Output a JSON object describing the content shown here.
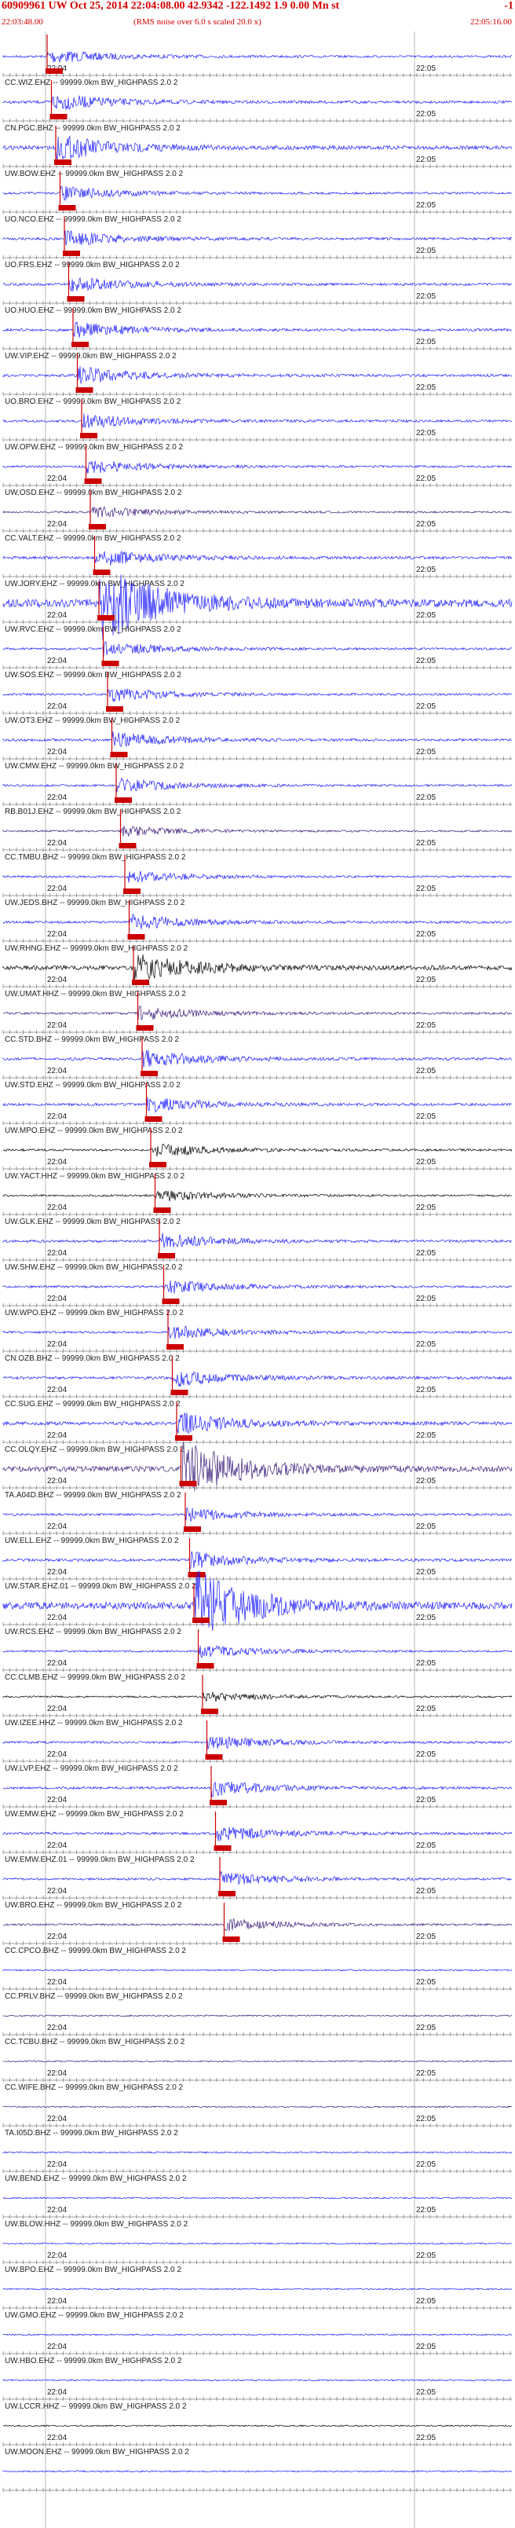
{
  "header": {
    "event_line": "60909961 UW Oct 25, 2014 22:04:08.00   42.9342 -122.1492  1.9 0.00 Mn st",
    "event_tail": "-1",
    "start_time": "22:03:48.00",
    "note": "(RMS noise over 6.0 s scaled 20.0 x)",
    "end_time": "22:05:16.00"
  },
  "chart_data": {
    "type": "seismogram",
    "time_range": [
      "22:03:48.00",
      "22:05:16.00"
    ],
    "minute_ticks": [
      "22:04",
      "22:05"
    ],
    "pick_color": "#cc0000",
    "traces": [
      {
        "label": "",
        "color": "#1a1aff",
        "amplitude": 0.45,
        "pick_s": 0,
        "tick_24": "22:04",
        "tick_25": "22:05"
      },
      {
        "label": "CC.WIZ.EHZ -- 99999.0km BW_HIGHPASS  2.0  2",
        "color": "#1a1aff",
        "amplitude": 0.55,
        "pick_s": 0,
        "tick_24": "",
        "tick_25": "22:05"
      },
      {
        "label": "CN.PGC.BHZ -- 99999.0km BW_HIGHPASS  2.0  2",
        "color": "#1a1aff",
        "amplitude": 0.8,
        "pick_s": 0,
        "tick_24": "",
        "tick_25": "22:05"
      },
      {
        "label": "UW.BOW.EHZ -- 99999.0km BW_HIGHPASS  2.0  2",
        "color": "#1a1aff",
        "amplitude": 0.45,
        "pick_s": 0,
        "tick_24": "",
        "tick_25": "22:05"
      },
      {
        "label": "UO.NCO.EHZ -- 99999.0km BW_HIGHPASS  2.0  2",
        "color": "#1a1aff",
        "amplitude": 0.5,
        "pick_s": 0,
        "tick_24": "",
        "tick_25": "22:05"
      },
      {
        "label": "UO.FRS.EHZ -- 99999.0km BW_HIGHPASS  2.0  2",
        "color": "#1a1aff",
        "amplitude": 0.5,
        "pick_s": 0,
        "tick_24": "",
        "tick_25": "22:05"
      },
      {
        "label": "UO.HUO.EHZ -- 99999.0km BW_HIGHPASS  2.0  2",
        "color": "#1a1aff",
        "amplitude": 0.5,
        "pick_s": 0,
        "tick_24": "",
        "tick_25": "22:05"
      },
      {
        "label": "UW.VIP.EHZ -- 99999.0km BW_HIGHPASS  2.0  2",
        "color": "#1a1aff",
        "amplitude": 0.55,
        "pick_s": 0,
        "tick_24": "",
        "tick_25": "22:05"
      },
      {
        "label": "UO.BRO.EHZ -- 99999.0km BW_HIGHPASS  2.0  2",
        "color": "#1a1aff",
        "amplitude": 0.5,
        "pick_s": 0,
        "tick_24": "",
        "tick_25": "22:05"
      },
      {
        "label": "UW.OPW.EHZ -- 99999.0km BW_HIGHPASS  2.0  2",
        "color": "#1a1aff",
        "amplitude": 0.45,
        "pick_s": 0,
        "tick_24": "22:04",
        "tick_25": "22:05"
      },
      {
        "label": "UW.OSD.EHZ -- 99999.0km BW_HIGHPASS  2.0  2",
        "color": "#3a1a7a",
        "amplitude": 0.4,
        "pick_s": 0,
        "tick_24": "22:04",
        "tick_25": "22:05"
      },
      {
        "label": "CC.VALT.EHZ -- 99999.0km BW_HIGHPASS  2.0  2",
        "color": "#1a1aff",
        "amplitude": 0.55,
        "pick_s": 0,
        "tick_24": "",
        "tick_25": "22:05"
      },
      {
        "label": "UW.JORY.EHZ -- 99999.0km BW_HIGHPASS  2.0  2",
        "color": "#1a1aff",
        "amplitude": 1.6,
        "pick_s": 0,
        "tick_24": "22:04",
        "tick_25": "22:05"
      },
      {
        "label": "UW.RVC.EHZ -- 99999.0km BW_HIGHPASS  2.0  2",
        "color": "#1a1aff",
        "amplitude": 0.45,
        "pick_s": 0,
        "tick_24": "22:04",
        "tick_25": "22:05"
      },
      {
        "label": "UW.SOS.EHZ -- 99999.0km BW_HIGHPASS  2.0  2",
        "color": "#1a1aff",
        "amplitude": 0.45,
        "pick_s": 0,
        "tick_24": "22:04",
        "tick_25": "22:05"
      },
      {
        "label": "UW.OT3.EHZ -- 99999.0km BW_HIGHPASS  2.0  2",
        "color": "#1a1aff",
        "amplitude": 0.5,
        "pick_s": 0,
        "tick_24": "22:04",
        "tick_25": "22:05"
      },
      {
        "label": "UW.CMW.EHZ -- 99999.0km BW_HIGHPASS  2.0  2",
        "color": "#1a1aff",
        "amplitude": 0.45,
        "pick_s": 0,
        "tick_24": "22:04",
        "tick_25": "22:05"
      },
      {
        "label": "RB.B01J.EHZ -- 99999.0km BW_HIGHPASS  2.0  2",
        "color": "#3a1a7a",
        "amplitude": 0.35,
        "pick_s": 0,
        "tick_24": "22:04",
        "tick_25": "22:05"
      },
      {
        "label": "CC.TMBU.BHZ -- 99999.0km BW_HIGHPASS  2.0  2",
        "color": "#1a1aff",
        "amplitude": 0.4,
        "pick_s": 0,
        "tick_24": "22:04",
        "tick_25": "22:05"
      },
      {
        "label": "UW.JEDS.BHZ -- 99999.0km BW_HIGHPASS  2.0  2",
        "color": "#1a1aff",
        "amplitude": 0.5,
        "pick_s": 0,
        "tick_24": "22:04",
        "tick_25": "22:05"
      },
      {
        "label": "UW.RHNG.EHZ -- 99999.0km BW_HIGHPASS  2.0  2",
        "color": "#000000",
        "amplitude": 0.9,
        "pick_s": 0,
        "tick_24": "22:04",
        "tick_25": "22:05"
      },
      {
        "label": "UW.UMAT.HHZ -- 99999.0km BW_HIGHPASS  2.0  2",
        "color": "#3a1a7a",
        "amplitude": 0.45,
        "pick_s": 0,
        "tick_24": "22:04",
        "tick_25": "22:05"
      },
      {
        "label": "CC.STD.BHZ -- 99999.0km BW_HIGHPASS  2.0  2",
        "color": "#1a1aff",
        "amplitude": 0.55,
        "pick_s": 0,
        "tick_24": "22:04",
        "tick_25": "22:05"
      },
      {
        "label": "UW.STD.EHZ -- 99999.0km BW_HIGHPASS  2.0  2",
        "color": "#1a1aff",
        "amplitude": 0.5,
        "pick_s": 0,
        "tick_24": "22:04",
        "tick_25": "22:05"
      },
      {
        "label": "UW.MPO.EHZ -- 99999.0km BW_HIGHPASS  2.0  2",
        "color": "#000000",
        "amplitude": 0.45,
        "pick_s": 0,
        "tick_24": "22:04",
        "tick_25": "22:05"
      },
      {
        "label": "UW.YACT.HHZ -- 99999.0km BW_HIGHPASS  2.0  2",
        "color": "#000000",
        "amplitude": 0.4,
        "pick_s": 0,
        "tick_24": "22:04",
        "tick_25": "22:05"
      },
      {
        "label": "UW.GLK.EHZ -- 99999.0km BW_HIGHPASS  2.0  2",
        "color": "#1a1aff",
        "amplitude": 0.5,
        "pick_s": 0,
        "tick_24": "22:04",
        "tick_25": "22:05"
      },
      {
        "label": "UW.SHW.EHZ -- 99999.0km BW_HIGHPASS  2.0  2",
        "color": "#1a1aff",
        "amplitude": 0.45,
        "pick_s": 0,
        "tick_24": "22:04",
        "tick_25": "22:05"
      },
      {
        "label": "UW.WPO.EHZ -- 99999.0km BW_HIGHPASS  2.0  2",
        "color": "#1a1aff",
        "amplitude": 0.45,
        "pick_s": 0,
        "tick_24": "22:04",
        "tick_25": "22:05"
      },
      {
        "label": "CN.OZB.BHZ -- 99999.0km BW_HIGHPASS  2.0  2",
        "color": "#1a1aff",
        "amplitude": 0.55,
        "pick_s": 0,
        "tick_24": "22:04",
        "tick_25": "22:05"
      },
      {
        "label": "CC.SUG.EHZ -- 99999.0km BW_HIGHPASS  2.0  2",
        "color": "#1a1aff",
        "amplitude": 0.7,
        "pick_s": 0,
        "tick_24": "22:04",
        "tick_25": "22:05"
      },
      {
        "label": "CC.OLQY.EHZ -- 99999.0km BW_HIGHPASS  2.0  2",
        "color": "#3a1a7a",
        "amplitude": 1.1,
        "pick_s": 0,
        "tick_24": "22:04",
        "tick_25": "22:05"
      },
      {
        "label": "TA.A04D.BHZ -- 99999.0km BW_HIGHPASS  2.0  2",
        "color": "#1a1aff",
        "amplitude": 0.45,
        "pick_s": 0,
        "tick_24": "22:04",
        "tick_25": "22:05"
      },
      {
        "label": "UW.ELL.EHZ -- 99999.0km BW_HIGHPASS  2.0  2",
        "color": "#1a1aff",
        "amplitude": 0.55,
        "pick_s": 0,
        "tick_24": "22:04",
        "tick_25": "22:05"
      },
      {
        "label": "UW.STAR.EHZ.01 -- 99999.0km BW_HIGHPASS  2.0  2",
        "color": "#1a1aff",
        "amplitude": 1.4,
        "pick_s": 0,
        "tick_24": "22:04",
        "tick_25": "22:05"
      },
      {
        "label": "UW.RCS.EHZ -- 99999.0km BW_HIGHPASS  2.0  2",
        "color": "#1a1aff",
        "amplitude": 0.4,
        "pick_s": 0,
        "tick_24": "22:04",
        "tick_25": "22:05"
      },
      {
        "label": "CC.CLMB.EHZ -- 99999.0km BW_HIGHPASS  2.0  2",
        "color": "#000000",
        "amplitude": 0.35,
        "pick_s": 0,
        "tick_24": "22:04",
        "tick_25": "22:05"
      },
      {
        "label": "UW.IZEE.HHZ -- 99999.0km BW_HIGHPASS  2.0  2",
        "color": "#1a1aff",
        "amplitude": 0.45,
        "pick_s": 0,
        "tick_24": "22:04",
        "tick_25": "22:05"
      },
      {
        "label": "UW.LVP.EHZ -- 99999.0km BW_HIGHPASS  2.0  2",
        "color": "#1a1aff",
        "amplitude": 0.5,
        "pick_s": 0,
        "tick_24": "22:04",
        "tick_25": "22:05"
      },
      {
        "label": "UW.EMW.EHZ -- 99999.0km BW_HIGHPASS  2.0  2",
        "color": "#1a1aff",
        "amplitude": 0.5,
        "pick_s": 0,
        "tick_24": "22:04",
        "tick_25": "22:05"
      },
      {
        "label": "UW.EMW.EHZ.01 -- 99999.0km BW_HIGHPASS  2.0  2",
        "color": "#1a1aff",
        "amplitude": 0.45,
        "pick_s": 0,
        "tick_24": "22:04",
        "tick_25": "22:05"
      },
      {
        "label": "UW.BRO.EHZ -- 99999.0km BW_HIGHPASS  2.0  2",
        "color": "#3a1a7a",
        "amplitude": 0.4,
        "pick_s": 0,
        "tick_24": "22:04",
        "tick_25": "22:05"
      },
      {
        "label": "CC.CPCO.BHZ -- 99999.0km BW_HIGHPASS  2.0  2",
        "color": "#1a1aff",
        "amplitude": 0.3,
        "pick_s": null,
        "tick_24": "22:04",
        "tick_25": "22:05"
      },
      {
        "label": "CC.PRLV.BHZ -- 99999.0km BW_HIGHPASS  2.0  2",
        "color": "#3a1a7a",
        "amplitude": 0.3,
        "pick_s": null,
        "tick_24": "22:04",
        "tick_25": "22:05"
      },
      {
        "label": "CC.TCBU.BHZ -- 99999.0km BW_HIGHPASS  2.0  2",
        "color": "#3a1a7a",
        "amplitude": 0.3,
        "pick_s": null,
        "tick_24": "22:04",
        "tick_25": "22:05"
      },
      {
        "label": "CC.WIFE.BHZ -- 99999.0km BW_HIGHPASS  2.0  2",
        "color": "#3a1a7a",
        "amplitude": 0.3,
        "pick_s": null,
        "tick_24": "22:04",
        "tick_25": "22:05"
      },
      {
        "label": "TA.I05D.BHZ -- 99999.0km BW_HIGHPASS  2.0  2",
        "color": "#1a1aff",
        "amplitude": 0.3,
        "pick_s": null,
        "tick_24": "22:04",
        "tick_25": "22:05"
      },
      {
        "label": "UW.BEND.EHZ -- 99999.0km BW_HIGHPASS  2.0  2",
        "color": "#1a1aff",
        "amplitude": 0.3,
        "pick_s": null,
        "tick_24": "22:04",
        "tick_25": "22:05"
      },
      {
        "label": "UW.BLOW.HHZ -- 99999.0km BW_HIGHPASS  2.0  2",
        "color": "#1a1aff",
        "amplitude": 0.3,
        "pick_s": null,
        "tick_24": "22:04",
        "tick_25": "22:05"
      },
      {
        "label": "UW.BPO.EHZ -- 99999.0km BW_HIGHPASS  2.0  2",
        "color": "#1a1aff",
        "amplitude": 0.3,
        "pick_s": null,
        "tick_24": "22:04",
        "tick_25": "22:05"
      },
      {
        "label": "UW.GMO.EHZ -- 99999.0km BW_HIGHPASS  2.0  2",
        "color": "#1a1aff",
        "amplitude": 0.3,
        "pick_s": null,
        "tick_24": "22:04",
        "tick_25": "22:05"
      },
      {
        "label": "UW.HBO.EHZ -- 99999.0km BW_HIGHPASS  2.0  2",
        "color": "#1a1aff",
        "amplitude": 0.3,
        "pick_s": null,
        "tick_24": "22:04",
        "tick_25": "22:05"
      },
      {
        "label": "UW.LCCR.HHZ -- 99999.0km BW_HIGHPASS  2.0  2",
        "color": "#000000",
        "amplitude": 0.3,
        "pick_s": null,
        "tick_24": "22:04",
        "tick_25": "22:05"
      },
      {
        "label": "UW.MOON.EHZ -- 99999.0km BW_HIGHPASS  2.0  2",
        "color": "#1a1aff",
        "amplitude": 0.3,
        "pick_s": null,
        "tick_24": "",
        "tick_25": ""
      }
    ]
  }
}
